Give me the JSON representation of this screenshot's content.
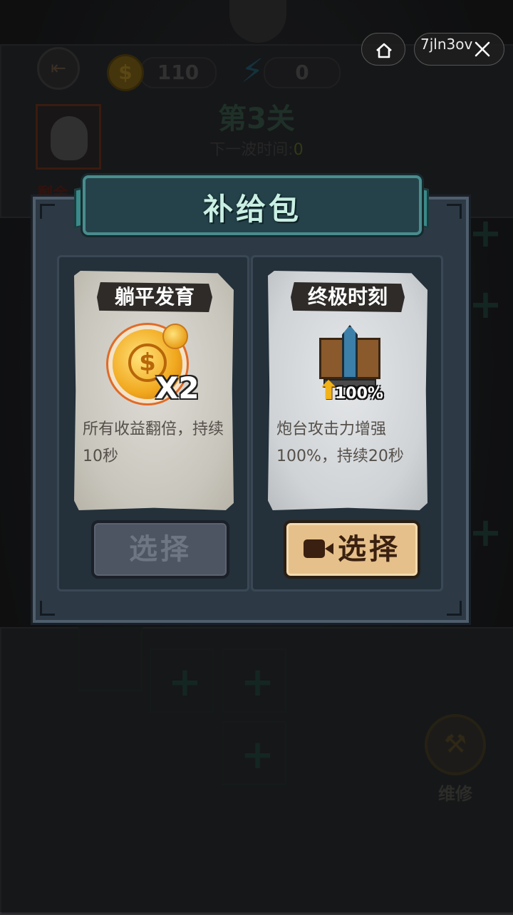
{
  "hud": {
    "coins": "110",
    "energy": "0",
    "level_title": "第3关",
    "wave_label": "下一波时间:",
    "wave_value": "0",
    "remaining_label": "剩余",
    "repair_label": "维修"
  },
  "system": {
    "capsule_id": "7jln3ov"
  },
  "dialog": {
    "title": "补给包",
    "options": [
      {
        "name": "躺平发育",
        "badge": "X2",
        "description": "所有收益翻倍，持续10秒",
        "button_label": "选择",
        "enabled": false
      },
      {
        "name": "终极时刻",
        "badge": "100%",
        "description": "炮台攻击力增强100%，持续20秒",
        "button_label": "选择",
        "enabled": true,
        "requires_video": true
      }
    ]
  },
  "colors": {
    "dialog_bg": "#2d3a46",
    "title_text": "#c9efe3",
    "active_button": "#e6c08a",
    "disabled_button": "#4d5562"
  },
  "icons": [
    "exit-icon",
    "coin-icon",
    "lightning-icon",
    "home-icon",
    "more-icon",
    "close-icon",
    "gold-coin-icon",
    "tower-icon",
    "attack-up-icon",
    "video-icon",
    "drill-icon"
  ]
}
